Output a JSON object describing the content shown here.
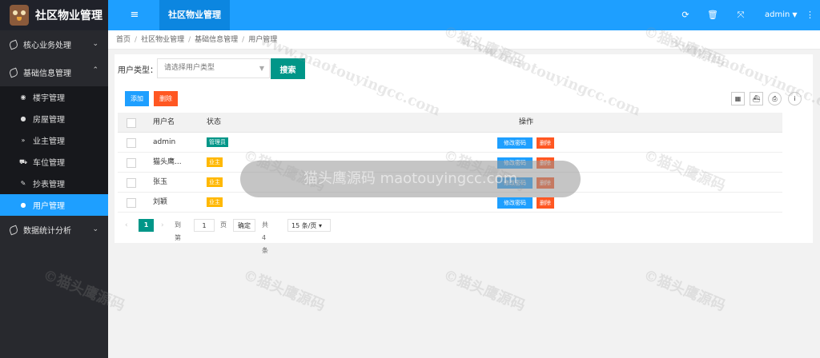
{
  "app": {
    "title": "社区物业管理",
    "active_tab": "社区物业管理",
    "user": "admin",
    "menu_toggle_icon": "menu-lines-icon",
    "header_icons": [
      "refresh-icon",
      "trash-icon",
      "fullscreen-icon",
      "more-vertical-icon"
    ]
  },
  "sidebar": {
    "groups": [
      {
        "label": "核心业务处理",
        "expanded": false
      },
      {
        "label": "基础信息管理",
        "expanded": true
      },
      {
        "label": "数据统计分析",
        "expanded": false
      }
    ],
    "items": [
      {
        "label": "楼宇管理",
        "icon": "target-icon"
      },
      {
        "label": "房屋管理",
        "icon": "home-icon"
      },
      {
        "label": "业主管理",
        "icon": "chevrons-down-icon"
      },
      {
        "label": "车位管理",
        "icon": "car-icon"
      },
      {
        "label": "抄表管理",
        "icon": "edit-icon"
      },
      {
        "label": "用户管理",
        "icon": "user-icon",
        "active": true
      }
    ]
  },
  "breadcrumb": [
    "首页",
    "社区物业管理",
    "基础信息管理",
    "用户管理"
  ],
  "search": {
    "label": "用户类型：",
    "placeholder": "请选择用户类型",
    "button": "搜索"
  },
  "toolbar": {
    "add": "添加",
    "delete": "删除"
  },
  "table": {
    "columns": [
      "用户名",
      "状态",
      "操作"
    ],
    "rows": [
      {
        "username": "admin",
        "status": "管理员",
        "status_type": "admin"
      },
      {
        "username": "猫头鹰...",
        "status": "业主",
        "status_type": "owner"
      },
      {
        "username": "张玉",
        "status": "业主",
        "status_type": "owner"
      },
      {
        "username": "刘颖",
        "status": "业主",
        "status_type": "owner"
      }
    ],
    "actions": {
      "edit": "修改密码",
      "delete": "删除"
    }
  },
  "pager": {
    "current": "1",
    "goto_label": "到第",
    "goto_value": "1",
    "page_unit": "页",
    "confirm": "确定",
    "total": "共 4 条",
    "page_size": "15 条/页"
  },
  "watermark": {
    "cn": "©猫头鹰源码",
    "url": "www.maotouyingcc.com",
    "center": "猫头鹰源码 maotouyingcc.com"
  },
  "colors": {
    "header": "#1e9fff",
    "sidebar": "#28292e",
    "accent": "#009688",
    "danger": "#ff5722",
    "warning": "#ffb800"
  }
}
